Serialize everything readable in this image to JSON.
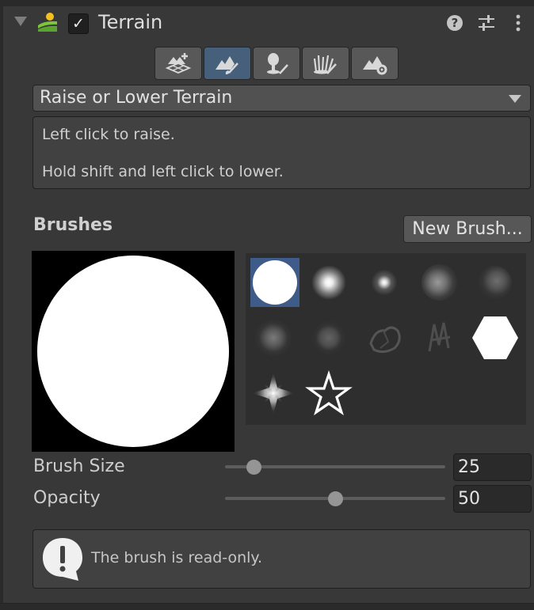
{
  "component": {
    "title": "Terrain",
    "enabled_mark": "✓",
    "icons": [
      "terrain-component-icon",
      "help-icon",
      "presets-icon",
      "more-options-icon"
    ]
  },
  "toolbar": {
    "tools": [
      {
        "name": "create-neighbor-terrains-icon",
        "active": false
      },
      {
        "name": "paint-terrain-icon",
        "active": true
      },
      {
        "name": "paint-trees-icon",
        "active": false
      },
      {
        "name": "paint-details-icon",
        "active": false
      },
      {
        "name": "terrain-settings-icon",
        "active": false
      }
    ]
  },
  "mode_dropdown": {
    "selected": "Raise or Lower Terrain"
  },
  "help": {
    "line1": "Left click to raise.",
    "line2": "Hold shift and left click to lower."
  },
  "brushes": {
    "label": "Brushes",
    "new_brush_label": "New Brush...",
    "selected_index": 0,
    "count": 12
  },
  "brush_size": {
    "label": "Brush Size",
    "value": "25",
    "fraction": 0.13
  },
  "opacity": {
    "label": "Opacity",
    "value": "50",
    "fraction": 0.5
  },
  "info": {
    "message": "The brush is read-only."
  },
  "colors": {
    "accent": "#46607c",
    "selected_brush": "#3f5b8a",
    "panel": "#383838"
  }
}
